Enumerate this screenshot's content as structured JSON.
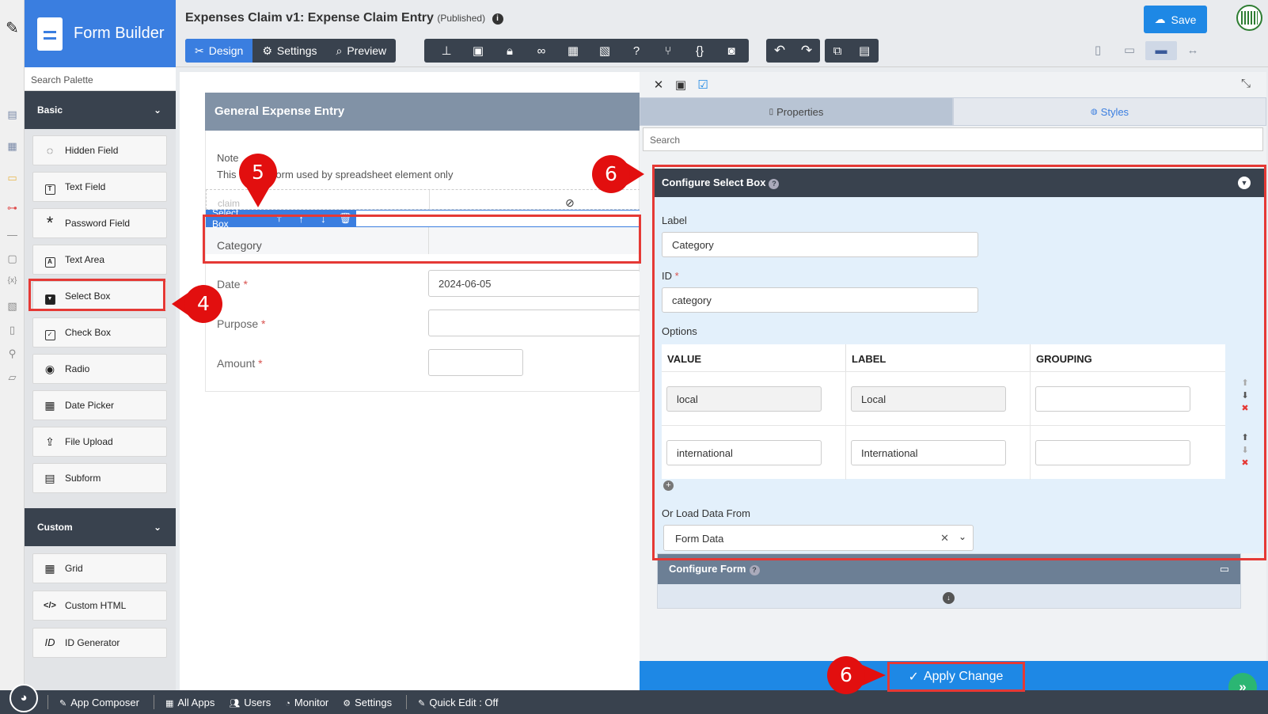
{
  "app": {
    "brand_title": "Form Builder",
    "form_title": "Expenses Claim v1: Expense Claim Entry",
    "status": "(Published)",
    "save_label": "Save"
  },
  "tabs": [
    {
      "label": "Design",
      "icon": "design-icon"
    },
    {
      "label": "Settings",
      "icon": "gear-icon"
    },
    {
      "label": "Preview",
      "icon": "preview-icon"
    }
  ],
  "palette": {
    "search_placeholder": "Search Palette",
    "basic_label": "Basic",
    "custom_label": "Custom",
    "basic_items": [
      {
        "label": "Hidden Field",
        "icon": "eye-slash-icon"
      },
      {
        "label": "Text Field",
        "icon": "text-field-icon"
      },
      {
        "label": "Password Field",
        "icon": "asterisk-icon"
      },
      {
        "label": "Text Area",
        "icon": "text-area-icon"
      },
      {
        "label": "Select Box",
        "icon": "select-box-icon"
      },
      {
        "label": "Check Box",
        "icon": "checkbox-icon"
      },
      {
        "label": "Radio",
        "icon": "radio-icon"
      },
      {
        "label": "Date Picker",
        "icon": "calendar-icon"
      },
      {
        "label": "File Upload",
        "icon": "upload-icon"
      },
      {
        "label": "Subform",
        "icon": "subform-icon"
      }
    ],
    "custom_items": [
      {
        "label": "Grid",
        "icon": "grid-icon"
      },
      {
        "label": "Custom HTML",
        "icon": "code-icon"
      },
      {
        "label": "ID Generator",
        "icon": "id-icon"
      }
    ]
  },
  "canvas": {
    "section_title": "General Expense Entry",
    "note_line1": "Note",
    "note_line2": "This hidden form used by spreadsheet element only",
    "hidden_label": "claim",
    "select_toolbar_label": "Select Box",
    "category_label": "Category",
    "date_label": "Date",
    "date_value": "2024-06-05",
    "purpose_label": "Purpose",
    "amount_label": "Amount",
    "required_mark": "*"
  },
  "properties": {
    "tab_properties": "Properties",
    "tab_styles": "Styles",
    "search_placeholder": "Search",
    "config_title": "Configure Select Box",
    "label_caption": "Label",
    "label_value": "Category",
    "id_caption": "ID",
    "id_value": "category",
    "options_caption": "Options",
    "columns": [
      "VALUE",
      "LABEL",
      "GROUPING"
    ],
    "options": [
      {
        "value": "local",
        "label": "Local",
        "grouping": ""
      },
      {
        "value": "international",
        "label": "International",
        "grouping": ""
      }
    ],
    "load_caption": "Or Load Data From",
    "load_value": "Form Data",
    "config_form_title": "Configure Form",
    "apply_label": "Apply Change"
  },
  "bottom_bar": {
    "items": [
      "App Composer",
      "All Apps",
      "Users",
      "Monitor",
      "Settings",
      "Quick Edit : Off"
    ]
  },
  "annotations": {
    "step4": "4",
    "step5": "5",
    "step6a": "6",
    "step6b": "6"
  },
  "colors": {
    "accent": "#1e88e5",
    "dark": "#39424e",
    "highlight": "#e53935"
  }
}
